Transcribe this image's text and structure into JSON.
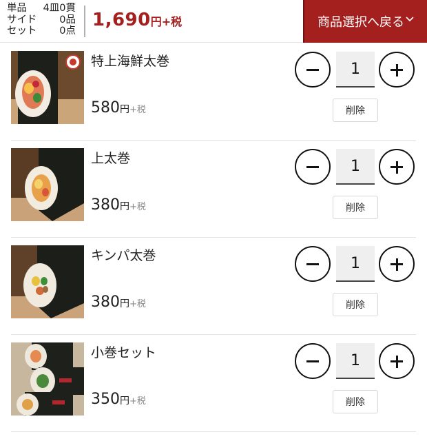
{
  "header": {
    "summary": [
      {
        "label": "単品",
        "value": "4皿0貫"
      },
      {
        "label": "サイド",
        "value": "0品"
      },
      {
        "label": "セット",
        "value": "0点"
      }
    ],
    "total_amount": "1,690",
    "total_unit": "円+税",
    "back_label": "商品選択へ戻る",
    "accent_color": "#a3201f"
  },
  "items": [
    {
      "name": "特上海鮮太巻",
      "price": "580",
      "price_unit": "円",
      "tax": "+税",
      "quantity": "1",
      "decrease_icon": "minus-icon",
      "increase_icon": "plus-icon",
      "delete_label": "削除"
    },
    {
      "name": "上太巻",
      "price": "380",
      "price_unit": "円",
      "tax": "+税",
      "quantity": "1",
      "decrease_icon": "minus-icon",
      "increase_icon": "plus-icon",
      "delete_label": "削除"
    },
    {
      "name": "キンパ太巻",
      "price": "380",
      "price_unit": "円",
      "tax": "+税",
      "quantity": "1",
      "decrease_icon": "minus-icon",
      "increase_icon": "plus-icon",
      "delete_label": "削除"
    },
    {
      "name": "小巻セット",
      "price": "350",
      "price_unit": "円",
      "tax": "+税",
      "quantity": "1",
      "decrease_icon": "minus-icon",
      "increase_icon": "plus-icon",
      "delete_label": "削除"
    }
  ]
}
